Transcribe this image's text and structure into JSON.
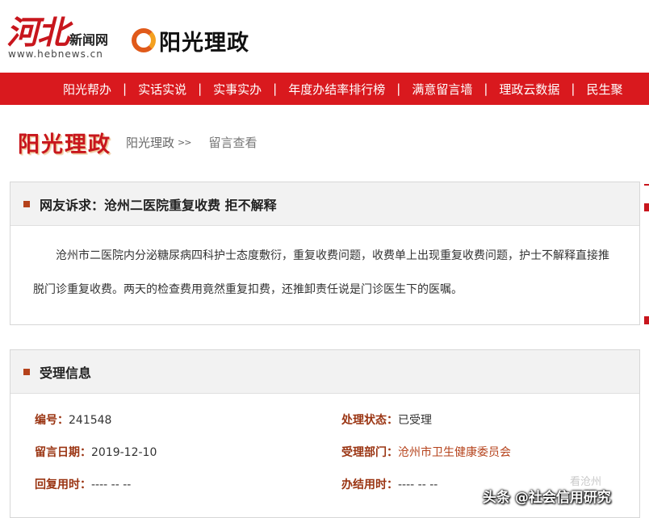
{
  "header": {
    "site_logo_main": "河北",
    "site_logo_sub": "新闻网",
    "site_url": "www.hebnews.cn",
    "brand_logo": "阳光理政"
  },
  "nav": {
    "items": [
      "阳光帮办",
      "实话实说",
      "实事实办",
      "年度办结率排行榜",
      "满意留言墙",
      "理政云数据",
      "民生聚"
    ],
    "separator": "|"
  },
  "breadcrumb": {
    "title": "阳光理政",
    "link": "阳光理政",
    "arrow": ">>",
    "current": "留言查看"
  },
  "complaint": {
    "heading": "网友诉求：沧州二医院重复收费 拒不解释",
    "body": "沧州市二医院内分泌糖尿病四科护士态度敷衍，重复收费问题，收费单上出现重复收费问题，护士不解释直接推脱门诊重复收费。两天的检查费用竟然重复扣费，还推卸责任说是门诊医生下的医嘱。"
  },
  "processing": {
    "heading": "受理信息",
    "number_label": "编号：",
    "number_value": "241548",
    "status_label": "处理状态：",
    "status_value": "已受理",
    "date_label": "留言日期：",
    "date_value": "2019-12-10",
    "dept_label": "受理部门：",
    "dept_value": "沧州市卫生健康委员会",
    "reply_label": "回复用时：",
    "reply_value": "---- -- --",
    "finish_label": "办结用时：",
    "finish_value": "---- -- --"
  },
  "watermark": {
    "faint": "看沧州",
    "text": "头条 @社会信用研究"
  },
  "colors": {
    "nav_bg": "#d9191e",
    "brand_red": "#c8161d",
    "label_brown": "#9a3412",
    "bullet": "#b5421b"
  }
}
